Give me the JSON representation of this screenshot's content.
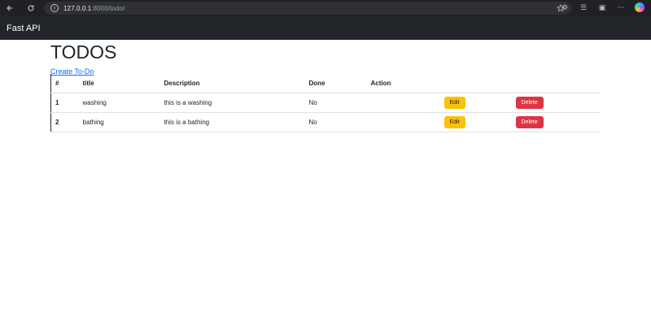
{
  "browser": {
    "url_host": "127.0.0.1",
    "url_rest": ":8000/todo/"
  },
  "navbar": {
    "brand": "Fast API"
  },
  "page": {
    "title": "TODOS",
    "create_link": "Create To-Do"
  },
  "table": {
    "headers": [
      "#",
      "title",
      "Description",
      "Done",
      "Action"
    ],
    "rows": [
      {
        "id": "1",
        "title": "washing",
        "description": "this is a washing",
        "done": "No",
        "edit": "Edit",
        "delete": "Delete"
      },
      {
        "id": "2",
        "title": "bathing",
        "description": "this is a bathing",
        "done": "No",
        "edit": "Edit",
        "delete": "Delete"
      }
    ]
  },
  "colors": {
    "edit_button": "#ffc107",
    "delete_button": "#dc3545",
    "link": "#0d6efd",
    "navbar": "#212529"
  }
}
